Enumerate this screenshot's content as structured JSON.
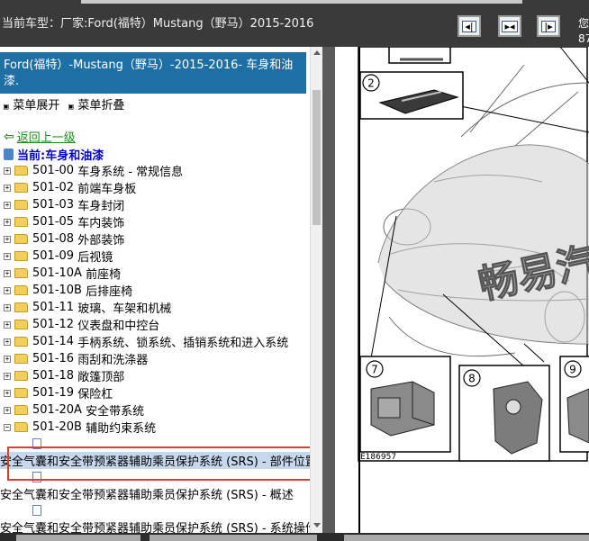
{
  "topbar": {
    "title": "当前车型：厂家:Ford(福特）Mustang（野马）2015-2016",
    "buttons": [
      {
        "name": "first-page-button",
        "glyph": "◂|"
      },
      {
        "name": "fit-page-button",
        "glyph": "▸◂"
      },
      {
        "name": "next-page-button",
        "glyph": "|▸"
      }
    ],
    "corner_lines": [
      "您",
      "87"
    ]
  },
  "left": {
    "header": "Ford(福特）-Mustang（野马）-2015-2016- 车身和油漆.",
    "expand_label": "菜单展开",
    "collapse_label": "菜单折叠",
    "back_label": "返回上一级",
    "current_label": "当前:车身和油漆",
    "tree_items": [
      {
        "code": "501-00",
        "label": "车身系统 - 常规信息"
      },
      {
        "code": "501-02",
        "label": "前端车身板"
      },
      {
        "code": "501-03",
        "label": "车身封闭"
      },
      {
        "code": "501-05",
        "label": "车内装饰"
      },
      {
        "code": "501-08",
        "label": "外部装饰"
      },
      {
        "code": "501-09",
        "label": "后视镜"
      },
      {
        "code": "501-10A",
        "label": "前座椅"
      },
      {
        "code": "501-10B",
        "label": "后排座椅"
      },
      {
        "code": "501-11",
        "label": "玻璃、车架和机械"
      },
      {
        "code": "501-12",
        "label": "仪表盘和中控台"
      },
      {
        "code": "501-14",
        "label": "手柄系统、锁系统、插销系统和进入系统"
      },
      {
        "code": "501-16",
        "label": "雨刮和洗涤器"
      },
      {
        "code": "501-18",
        "label": "敞篷顶部"
      },
      {
        "code": "501-19",
        "label": "保险杠"
      },
      {
        "code": "501-20A",
        "label": "安全带系统"
      },
      {
        "code": "501-20B",
        "label": "辅助约束系统"
      }
    ],
    "expanded_item": {
      "code": "501-20B",
      "label": "辅助约束系统"
    },
    "leaf_docs": [
      "安全气囊和安全带预紧器辅助乘员保护系统 (SRS) - 部件位置",
      "安全气囊和安全带预紧器辅助乘员保护系统 (SRS) - 概述",
      "安全气囊和安全带预紧器辅助乘员保护系统 (SRS) - 系统操作"
    ]
  },
  "diagram": {
    "callouts": [
      "2",
      "7",
      "8",
      "9"
    ],
    "figure_code": "E186957",
    "watermark": "畅易汽"
  },
  "colors": {
    "header_bg": "#1e6fa3",
    "topbar_bg": "#3a3a3a",
    "selection_bg": "#c7d8ee",
    "highlight_border": "#e53935"
  }
}
